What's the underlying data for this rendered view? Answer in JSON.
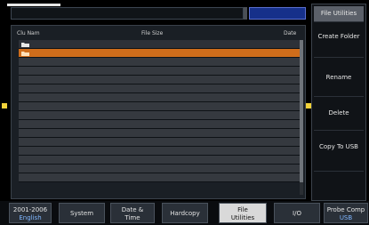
{
  "file_list": {
    "headers": {
      "name": "Clu Nam",
      "size": "File Size",
      "date": "Date"
    },
    "rows": [
      {
        "name": "",
        "type": "folder"
      },
      {
        "name": "",
        "type": "folder",
        "selected": true
      }
    ]
  },
  "side_menu": {
    "title": "File Utilities",
    "items": [
      {
        "label": "Create Folder"
      },
      {
        "label": "Rename"
      },
      {
        "label": "Delete"
      },
      {
        "label": "Copy To USB"
      }
    ]
  },
  "bottom_menu": [
    {
      "label": "2001-2006",
      "sub": "English"
    },
    {
      "label": "System",
      "sub": ""
    },
    {
      "label": "Date &",
      "sub": "Time"
    },
    {
      "label": "Hardcopy",
      "sub": ""
    },
    {
      "label": "File",
      "sub": "Utilities",
      "active": true
    },
    {
      "label": "I/O",
      "sub": ""
    },
    {
      "label": "Probe Comp",
      "sub": "USB"
    }
  ],
  "colors": {
    "selection": "#cf6d1b",
    "trigger_marker": "#f2d23a",
    "status_blue": "#16308a"
  }
}
